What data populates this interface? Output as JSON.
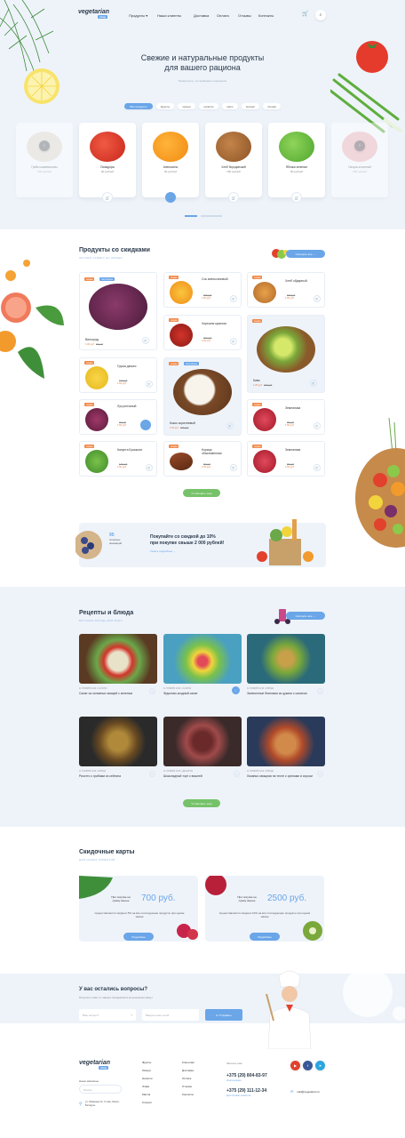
{
  "header": {
    "logo_text": "vegetarian",
    "logo_tag": "shop",
    "nav": [
      "Продукты",
      "Наши клиенты",
      "Доставка",
      "Оплата",
      "Отзывы",
      "Контакты"
    ]
  },
  "hero": {
    "title_line1": "Свежие и натуральные продукты",
    "title_line2": "для вашего рациона",
    "subtitle": "Посмотрите, что выбирают покупатели",
    "filters": [
      "Все продукты",
      "фрукты",
      "овощи",
      "напитки",
      "мясо",
      "молоко",
      "специи"
    ],
    "cards": [
      {
        "name": "Грибы шампиньоны",
        "price": "250 рублей",
        "faded": true
      },
      {
        "name": "Помидоры",
        "price": "90 рублей"
      },
      {
        "name": "Апельсины",
        "price": "90 рублей"
      },
      {
        "name": "Хлеб бородинский",
        "price": "150 рублей"
      },
      {
        "name": "Яблоки зеленые",
        "price": "90 рублей"
      },
      {
        "name": "Окорок копченый",
        "price": "350 рублей",
        "faded": true
      }
    ]
  },
  "discount_products": {
    "title": "Продукты со скидками",
    "subtitle": "ЛЕТНЯЯ СКИДКА НА ОВОЩИ",
    "show_all": "Смотреть все",
    "show_more": "Смотреть еще",
    "items": [
      {
        "name": "Виноград",
        "price": "1.90 руб",
        "old": "90 руб",
        "badges": [
          "скидка",
          "популярное"
        ]
      },
      {
        "name": "Сок апельсиновый",
        "price": "1.50 руб",
        "old": "150 руб",
        "badges": [
          "скидка"
        ]
      },
      {
        "name": "Хлеб обдирный",
        "price": "1.50 руб",
        "old": "150 руб",
        "badges": [
          "скидка"
        ]
      },
      {
        "name": "Черешня красная",
        "price": "1.50 руб",
        "old": "150 руб",
        "badges": [
          "скидка"
        ]
      },
      {
        "name": "Груша дюшес",
        "price": "1.50 руб",
        "old": "120 руб",
        "badges": [
          "скидка"
        ]
      },
      {
        "name": "Кокос коричневый",
        "price": "1.50 руб",
        "old": "150 руб",
        "badges": [
          "скидка",
          "популярное"
        ]
      },
      {
        "name": "Киви",
        "price": "1.20 руб",
        "old": "150 руб",
        "badges": [
          "скидка"
        ]
      },
      {
        "name": "Лук репчатый",
        "price": "1.50 руб",
        "old": "70 руб",
        "badges": [
          "скидка"
        ]
      },
      {
        "name": "Земляника",
        "price": "1.50 руб",
        "old": "90 руб",
        "badges": [
          "скидка"
        ]
      },
      {
        "name": "Капуста Брокколи",
        "price": "1.50 руб",
        "old": "120 руб",
        "badges": [
          "скидка"
        ]
      },
      {
        "name": "Корица обыкновенная",
        "price": "1.50 руб",
        "old": "90 руб",
        "badges": [
          "скидка"
        ]
      },
      {
        "name": "Земляника",
        "price": "1.50 руб",
        "old": "90 руб",
        "badges": [
          "скидка"
        ]
      }
    ]
  },
  "promo": {
    "title_line1": "Покупайте со скидкой до 10%",
    "title_line2": "при покупке свыше 2 000 рублей!",
    "link": "Узнать подробнее",
    "num": "95",
    "label": "полезных инноваций"
  },
  "recipes": {
    "title": "Рецепты и блюда",
    "subtitle": "ВКУСНЫЕ БЛЮДА ДЛЯ ВСЕХ",
    "show_all": "Смотреть все",
    "show_more": "Смотреть еще",
    "items": [
      {
        "date": "11 НОЯБРЯ 2019",
        "cat": "САЛАТЫ",
        "title": "Салат из основных овощей с зеленью"
      },
      {
        "date": "11 НОЯБРЯ 2019",
        "cat": "САЛАТЫ",
        "title": "Фруктово-ягодный салат"
      },
      {
        "date": "11 НОЯБРЯ 2019",
        "cat": "БЛЮДА",
        "title": "Запеченные блинчики из цукини с салатом"
      },
      {
        "date": "11 НОЯБРЯ 2019",
        "cat": "БЛЮДА",
        "title": "Ризотто с грибами из сейтана"
      },
      {
        "date": "11 НОЯБРЯ 2019",
        "cat": "ДЕСЕРТЫ",
        "title": "Шоколадный торт с вишней"
      },
      {
        "date": "11 НОЯБРЯ 2019",
        "cat": "БЛЮДА",
        "title": "Лазанья овощная на тесте с орехами и соусом"
      }
    ]
  },
  "cards": {
    "title": "Скидочные карты",
    "subtitle": "ДЛЯ НАШИХ КЛИЕНТОВ",
    "items": [
      {
        "cond": "При покупке на сумму свыше",
        "amount": "700 руб.",
        "desc": "предоставляется скидка в 5% на все последующие продукты при одном заказе",
        "btn": "Подробнее"
      },
      {
        "cond": "При покупке на сумму свыше",
        "amount": "2500 руб.",
        "desc": "предоставляется скидка в 10% на все последующие продукты при одном заказе",
        "btn": "Подробнее"
      }
    ]
  },
  "question": {
    "title": "У вас остались вопросы?",
    "subtitle": "Получите ответ от нашего специалиста за несколько минут",
    "q_placeholder": "Ваш вопрос?",
    "phone_placeholder": "Введите ваш email",
    "btn": "Отправить"
  },
  "footer": {
    "address_label": "Наши магазины",
    "search_placeholder": "Искать",
    "address": "ул. Макаенка 12, 3 этаж, Минск, Беларусь",
    "col1": [
      "Фрукты",
      "Овощи",
      "Напитки",
      "Злаки",
      "Масла",
      "Специи"
    ],
    "col2": [
      "Клиентам",
      "Доставка",
      "Оплата",
      "Отзывы",
      "Контакты"
    ],
    "call_label": "Звоните нам",
    "phone1": "+375 (29) 804-83-97",
    "phone1_note": "Консультация",
    "phone2": "+375 (29) 111-12-34",
    "phone2_note": "Для оптовых клиентов",
    "email": "mail@vegetarian.ru"
  }
}
